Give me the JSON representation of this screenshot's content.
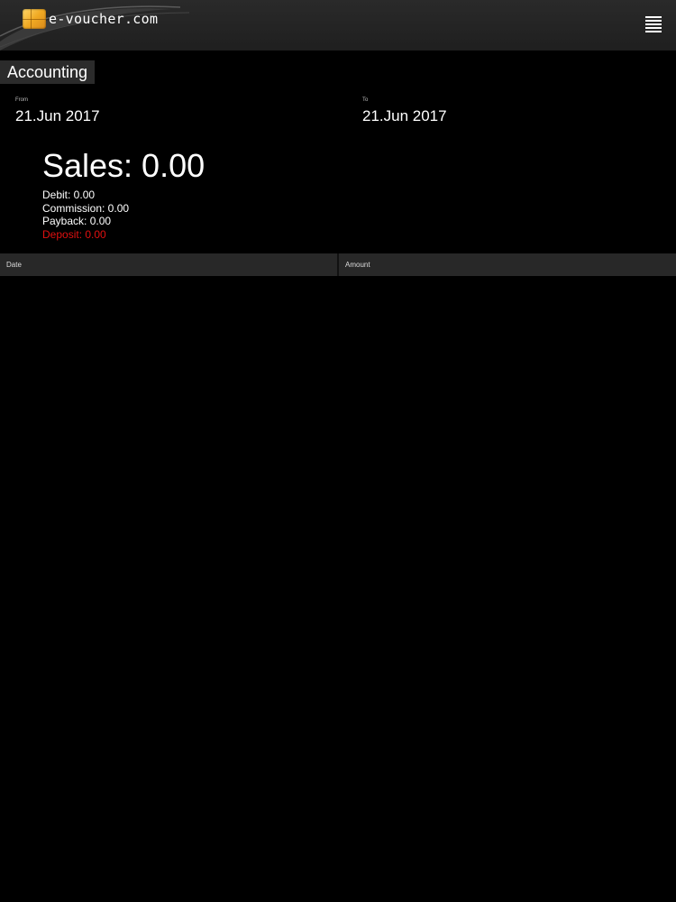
{
  "header": {
    "logo_text": "e-voucher.com",
    "menu_icon": "hamburger-menu-icon"
  },
  "page": {
    "title": "Accounting"
  },
  "filters": {
    "from_label": "From",
    "from_value": "21.Jun 2017",
    "to_label": "To",
    "to_value": "21.Jun 2017"
  },
  "summary": {
    "sales": "Sales: 0.00",
    "debit": "Debit: 0.00",
    "commission": "Commission: 0.00",
    "payback": "Payback: 0.00",
    "deposit": "Deposit: 0.00"
  },
  "table": {
    "columns": [
      "Date",
      "Amount"
    ],
    "rows": []
  },
  "colors": {
    "background": "#000000",
    "header": "#222222",
    "deposit": "#e01010",
    "accent_chip": "#f0a923"
  }
}
